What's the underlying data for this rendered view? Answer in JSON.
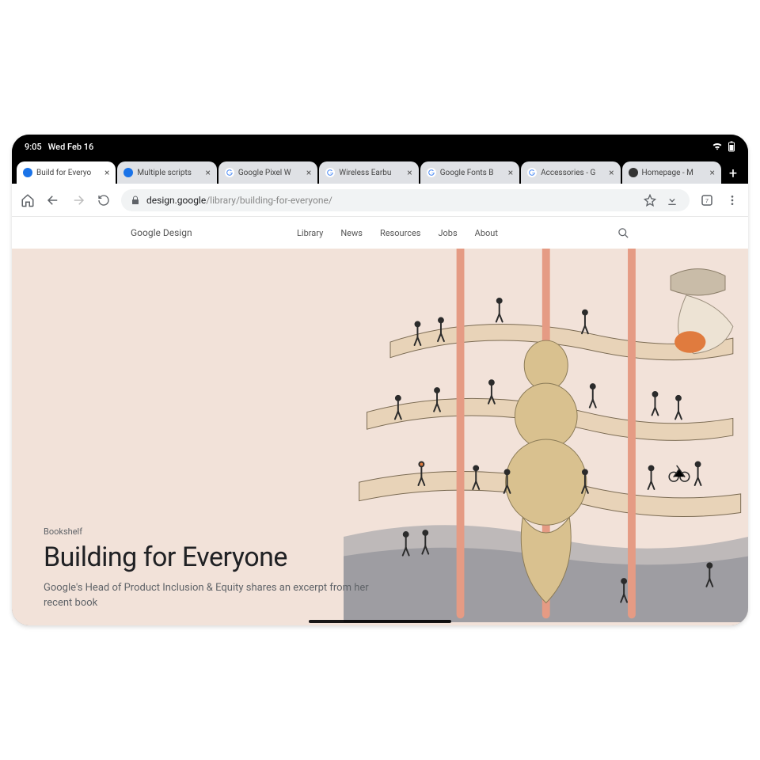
{
  "status": {
    "time": "9:05",
    "date": "Wed Feb 16"
  },
  "tabs": [
    {
      "title": "Build for Everyo",
      "favicon": "go-blue",
      "active": true
    },
    {
      "title": "Multiple scripts",
      "favicon": "go-blue",
      "active": false
    },
    {
      "title": "Google Pixel W",
      "favicon": "google-g",
      "active": false
    },
    {
      "title": "Wireless Earbu",
      "favicon": "google-g",
      "active": false
    },
    {
      "title": "Google Fonts B",
      "favicon": "google-g",
      "active": false
    },
    {
      "title": "Accessories - G",
      "favicon": "google-g",
      "active": false
    },
    {
      "title": "Homepage - M",
      "favicon": "dark",
      "active": false
    }
  ],
  "toolbar": {
    "url_host": "design.google",
    "url_path": "/library/building-for-everyone/"
  },
  "site": {
    "logo_a": "Google",
    "logo_b": " Design",
    "nav": [
      "Library",
      "News",
      "Resources",
      "Jobs",
      "About"
    ]
  },
  "hero": {
    "eyebrow": "Bookshelf",
    "headline": "Building for Everyone",
    "subhead": "Google's Head of Product Inclusion & Equity shares an excerpt from her recent book"
  }
}
